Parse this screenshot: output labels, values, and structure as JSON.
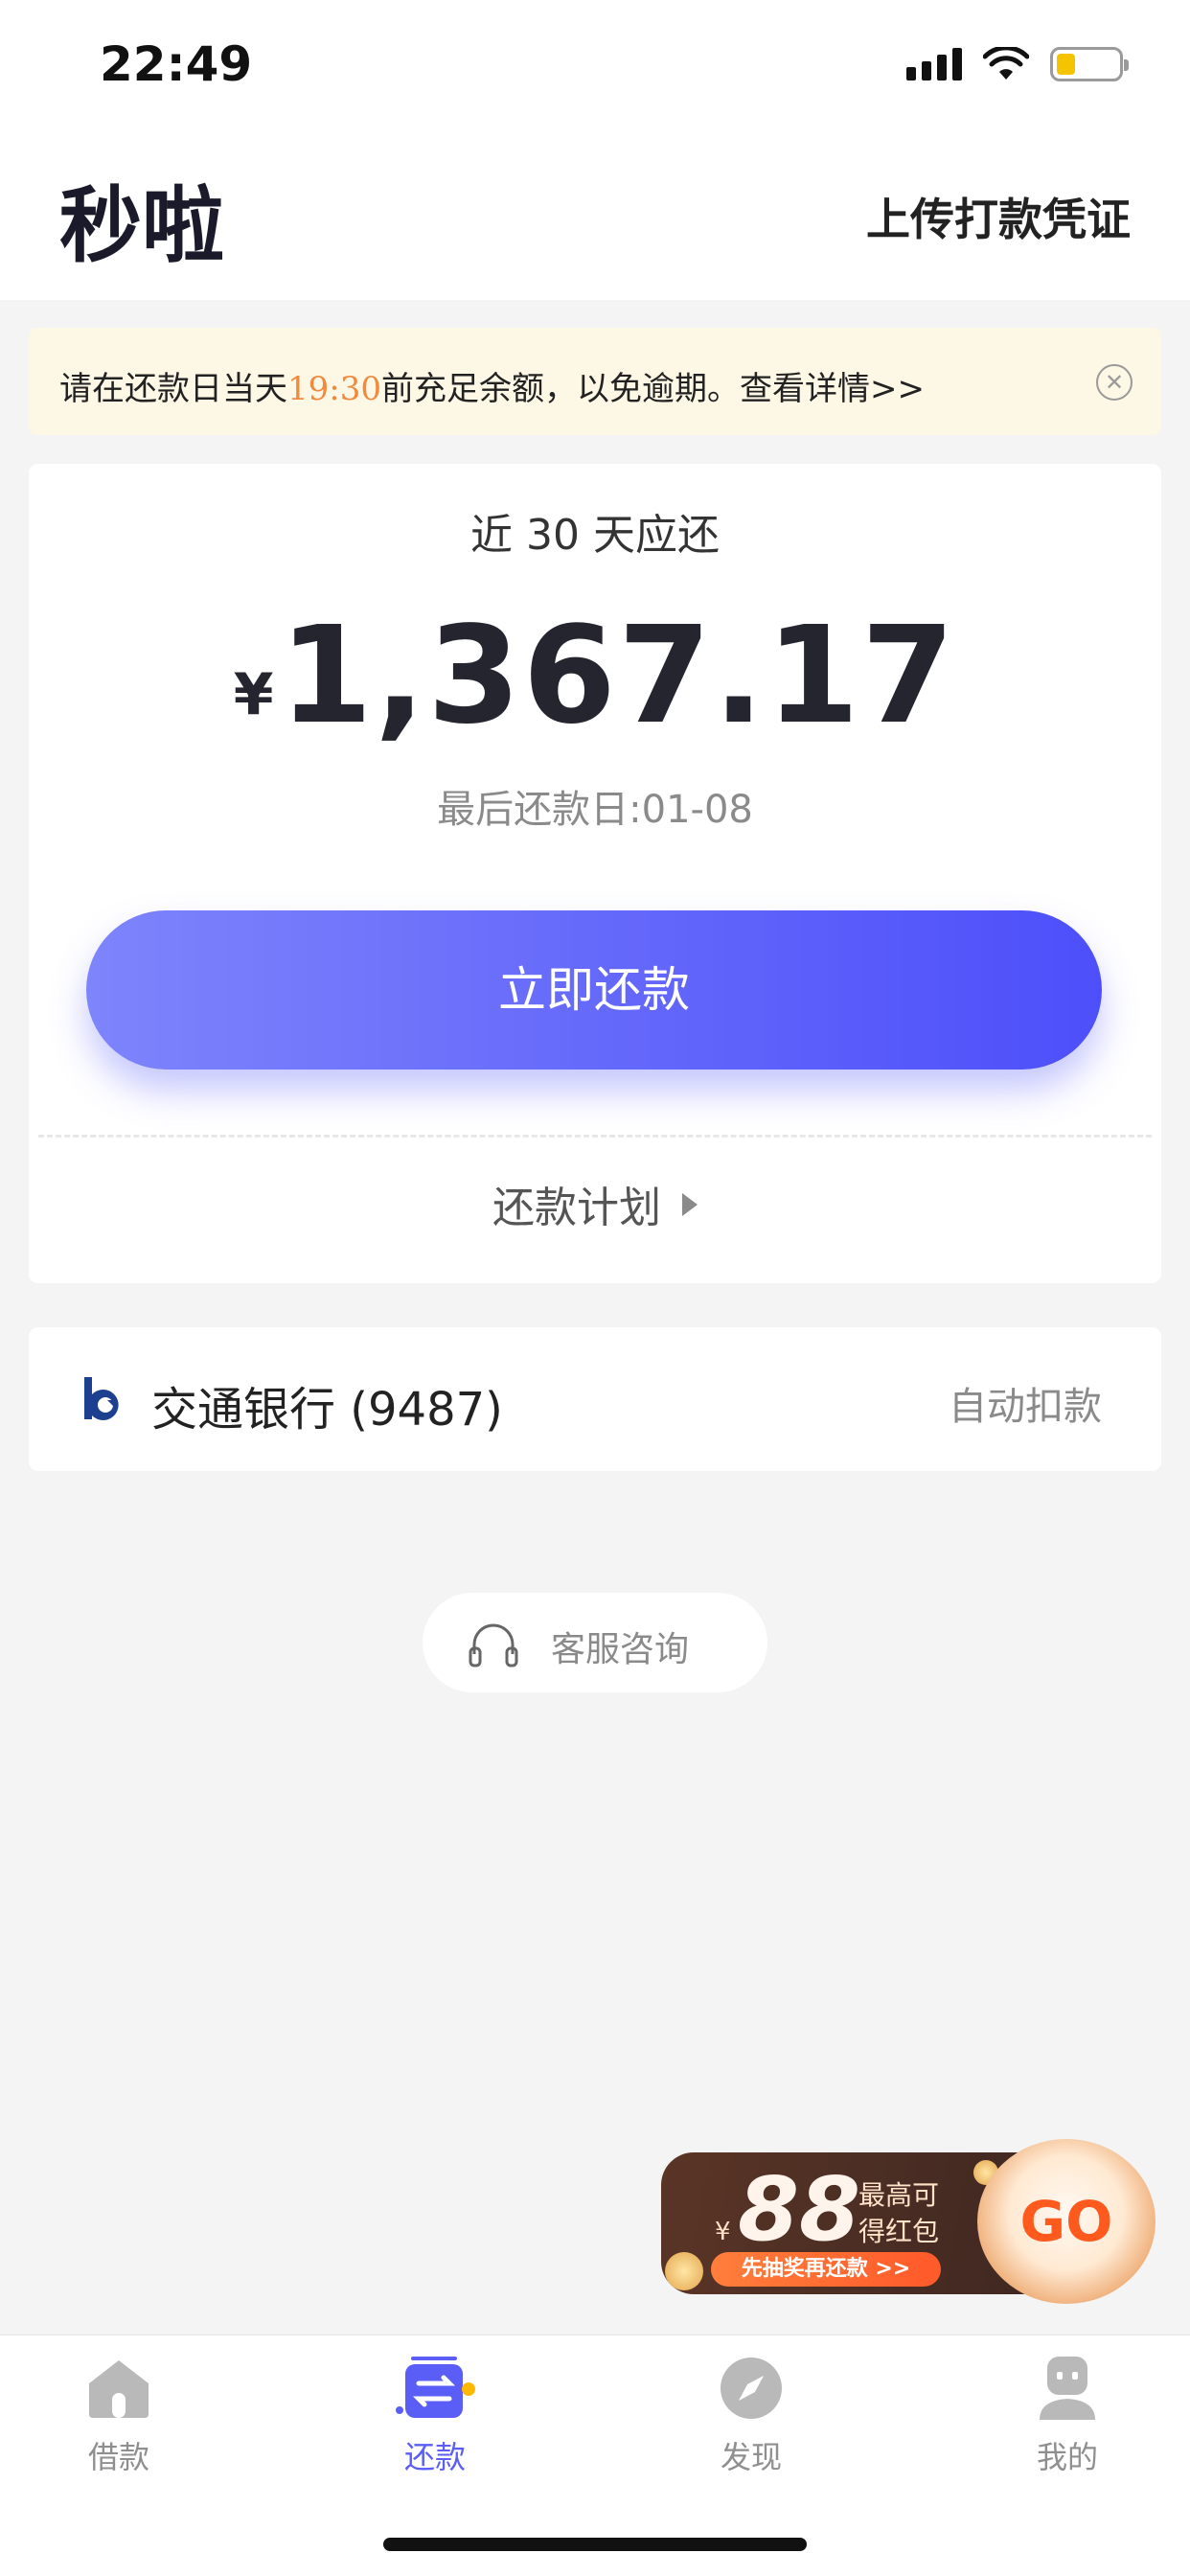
{
  "status_bar": {
    "time": "22:49"
  },
  "header": {
    "title": "秒啦",
    "upload_label": "上传打款凭证"
  },
  "notice": {
    "text_before": "请在还款日当天",
    "time": "19:30",
    "text_after": "前充足余额，以免逾期。查看详情>>"
  },
  "repay_card": {
    "label": "近 30 天应还",
    "currency": "¥",
    "amount": "1,367.17",
    "due": "最后还款日:01-08",
    "button_label": "立即还款",
    "plan_label": "还款计划"
  },
  "bank": {
    "name": "交通银行 (9487)",
    "mode": "自动扣款"
  },
  "service": {
    "label": "客服咨询"
  },
  "promo": {
    "currency": "¥",
    "amount": "88",
    "line1": "最高可",
    "line2": "得红包",
    "pill": "先抽奖再还款 >>",
    "go": "GO"
  },
  "tabs": [
    {
      "label": "借款",
      "icon": "home-icon",
      "active": false
    },
    {
      "label": "还款",
      "icon": "repay-icon",
      "active": true
    },
    {
      "label": "发现",
      "icon": "compass-icon",
      "active": false
    },
    {
      "label": "我的",
      "icon": "profile-icon",
      "active": false
    }
  ],
  "colors": {
    "accent": "#5b5ef6",
    "notice_bg": "#fdf7e6",
    "notice_highlight": "#f08a3c",
    "background": "#f4f4f4"
  }
}
